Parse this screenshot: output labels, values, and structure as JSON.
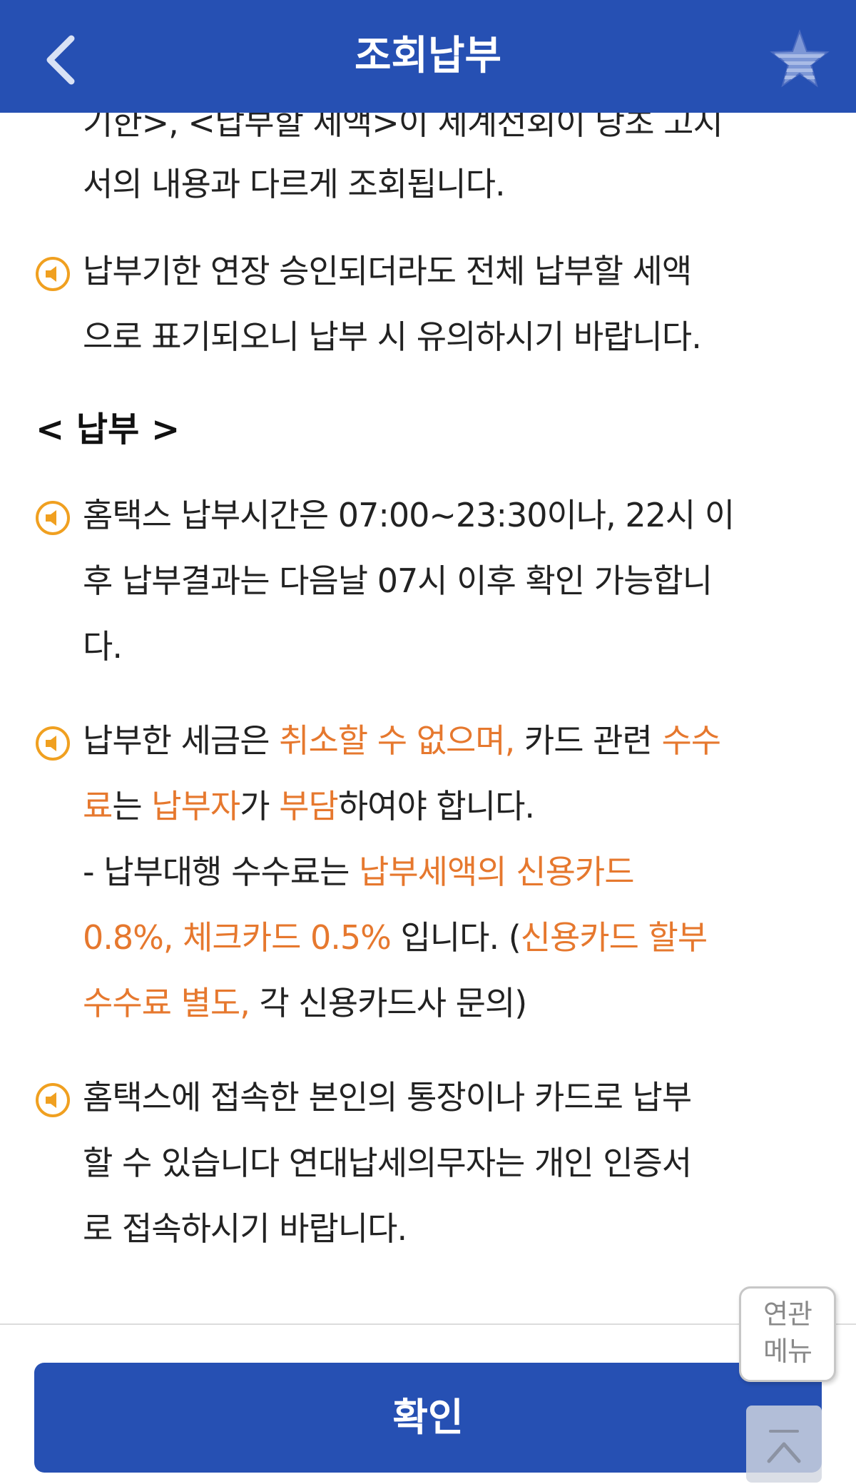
{
  "header": {
    "title": "조회납부",
    "back_icon": "chevron-left-icon",
    "favorite_icon": "star-icon"
  },
  "content": {
    "partial_line": "기한>, <납부할 세액>이 세계전회이 당초 고지",
    "continued_line": "서의 내용과 다르게 조회됩니다.",
    "notice_extension": {
      "lines": [
        "납부기한 연장 승인되더라도 전체 납부할 세액",
        "으로 표기되오니 납부 시 유의하시기 바랍니다."
      ]
    },
    "section_payment": "< 납부 >",
    "notice_time": {
      "lines": [
        "홈택스 납부시간은 07:00~23:30이나, 22시 이",
        "후 납부결과는 다음날 07시 이후 확인 가능합니",
        "다."
      ]
    },
    "notice_fee": {
      "l1_a": "납부한 세금은 ",
      "l1_b": "취소할 수 없으며,",
      "l1_c": " 카드 관련 ",
      "l1_d": "수수",
      "l2_a": "료",
      "l2_b": "는 ",
      "l2_c": "납부자",
      "l2_d": "가 ",
      "l2_e": "부담",
      "l2_f": "하여야 합니다.",
      "l3_a": "- 납부대행 수수료는 ",
      "l3_b": "납부세액의 신용카드",
      "l4_a": "0.8%, 체크카드 0.5%",
      "l4_b": " 입니다. (",
      "l4_c": "신용카드 할부",
      "l5_a": "수수료 별도,",
      "l5_b": " 각 신용카드사 문의)"
    },
    "notice_account": {
      "lines": [
        "홈택스에 접속한 본인의 통장이나 카드로 납부",
        "할 수 있습니다 연대납세의무자는 개인 인증서",
        "로 접속하시기 바랍니다."
      ]
    },
    "notice_icon": "speaker-icon"
  },
  "footer": {
    "confirm_label": "확인",
    "related_menu_line1": "연관",
    "related_menu_line2": "메뉴",
    "scroll_top_icon": "chevron-up-icon"
  },
  "colors": {
    "primary": "#2650b3",
    "highlight": "#e6782e",
    "icon_accent": "#f0a020"
  }
}
